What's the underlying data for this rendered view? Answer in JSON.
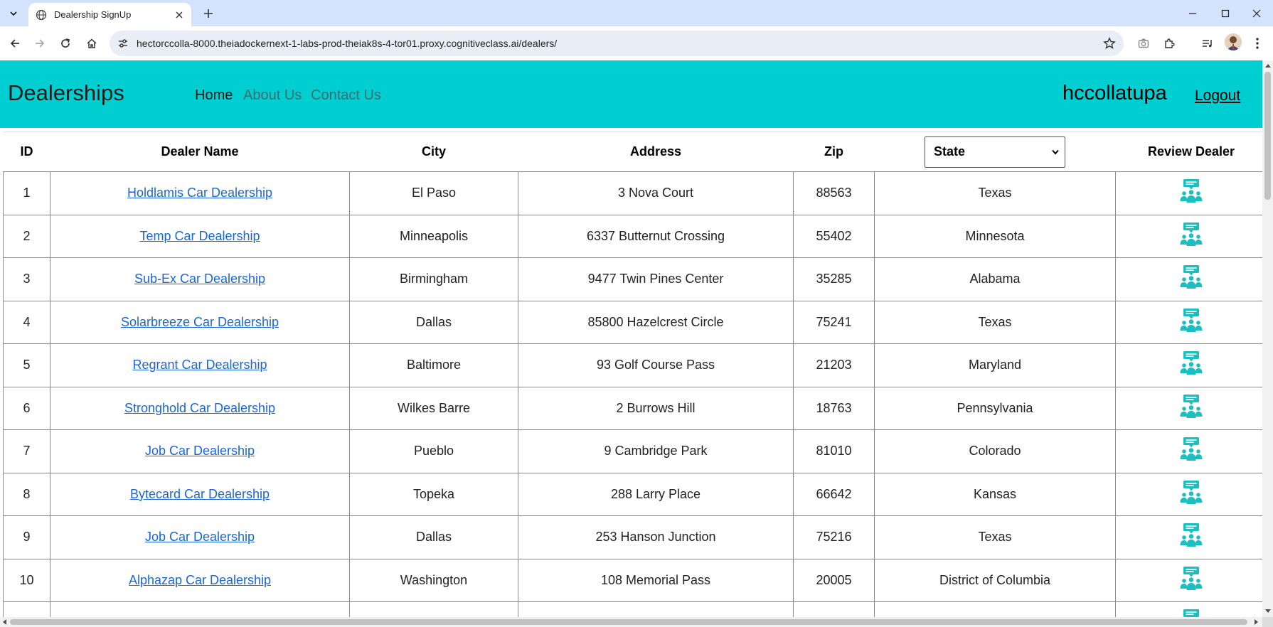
{
  "browser": {
    "tab_title": "Dealership SignUp",
    "url": "hectorccolla-8000.theiadockernext-1-labs-prod-theiak8s-4-tor01.proxy.cognitiveclass.ai/dealers/"
  },
  "navbar": {
    "brand": "Dealerships",
    "links": [
      "Home",
      "About Us",
      "Contact Us"
    ],
    "username": "hccollatupa",
    "logout": "Logout"
  },
  "table": {
    "headers": {
      "id": "ID",
      "name": "Dealer Name",
      "city": "City",
      "address": "Address",
      "zip": "Zip",
      "state_select": "State",
      "review": "Review Dealer"
    },
    "rows": [
      {
        "id": "1",
        "name": "Holdlamis Car Dealership",
        "city": "El Paso",
        "address": "3 Nova Court",
        "zip": "88563",
        "state": "Texas"
      },
      {
        "id": "2",
        "name": "Temp Car Dealership",
        "city": "Minneapolis",
        "address": "6337 Butternut Crossing",
        "zip": "55402",
        "state": "Minnesota"
      },
      {
        "id": "3",
        "name": "Sub-Ex Car Dealership",
        "city": "Birmingham",
        "address": "9477 Twin Pines Center",
        "zip": "35285",
        "state": "Alabama"
      },
      {
        "id": "4",
        "name": "Solarbreeze Car Dealership",
        "city": "Dallas",
        "address": "85800 Hazelcrest Circle",
        "zip": "75241",
        "state": "Texas"
      },
      {
        "id": "5",
        "name": "Regrant Car Dealership",
        "city": "Baltimore",
        "address": "93 Golf Course Pass",
        "zip": "21203",
        "state": "Maryland"
      },
      {
        "id": "6",
        "name": "Stronghold Car Dealership",
        "city": "Wilkes Barre",
        "address": "2 Burrows Hill",
        "zip": "18763",
        "state": "Pennsylvania"
      },
      {
        "id": "7",
        "name": "Job Car Dealership",
        "city": "Pueblo",
        "address": "9 Cambridge Park",
        "zip": "81010",
        "state": "Colorado"
      },
      {
        "id": "8",
        "name": "Bytecard Car Dealership",
        "city": "Topeka",
        "address": "288 Larry Place",
        "zip": "66642",
        "state": "Kansas"
      },
      {
        "id": "9",
        "name": "Job Car Dealership",
        "city": "Dallas",
        "address": "253 Hanson Junction",
        "zip": "75216",
        "state": "Texas"
      },
      {
        "id": "10",
        "name": "Alphazap Car Dealership",
        "city": "Washington",
        "address": "108 Memorial Pass",
        "zip": "20005",
        "state": "District of Columbia"
      },
      {
        "id": "",
        "name": "",
        "city": "",
        "address": "",
        "zip": "",
        "state": ""
      }
    ]
  },
  "colors": {
    "navbar_bg": "#00ced1",
    "link": "#1a66d9",
    "icon": "#1bbfbf"
  },
  "icons": [
    "chevron-down-icon",
    "globe-icon",
    "close-icon",
    "plus-icon",
    "minimize-icon",
    "maximize-icon",
    "close-window-icon",
    "back-icon",
    "forward-icon",
    "reload-icon",
    "home-icon",
    "site-settings-icon",
    "bookmark-star-icon",
    "camera-icon",
    "extensions-icon",
    "media-icon",
    "review-dealer-icon"
  ]
}
